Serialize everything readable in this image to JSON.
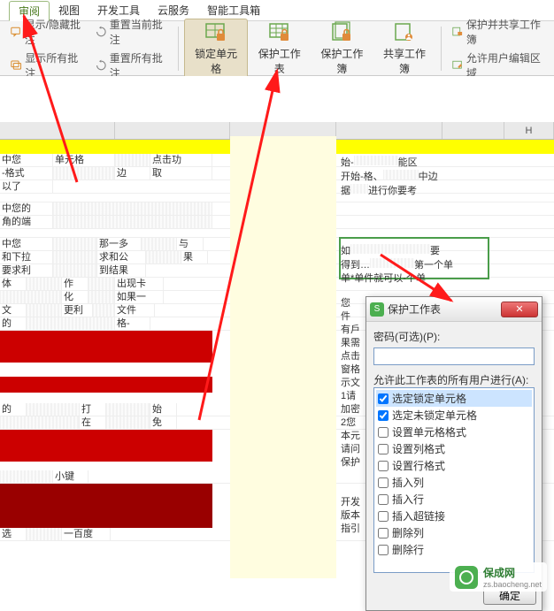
{
  "menu": {
    "items": [
      "审阅",
      "视图",
      "开发工具",
      "云服务",
      "智能工具箱"
    ],
    "active_index": 0
  },
  "ribbon": {
    "left": {
      "show_hide": "显示/隐藏批注",
      "show_all": "显示所有批注",
      "reset_current": "重置当前批注",
      "reset_all": "重置所有批注"
    },
    "big": [
      {
        "label": "锁定单元格",
        "active": true
      },
      {
        "label": "保护工作表",
        "active": false
      },
      {
        "label": "保护工作簿",
        "active": false
      },
      {
        "label": "共享工作簿",
        "active": false
      }
    ],
    "right": {
      "protect_share": "保护并共享工作簿",
      "allow_edit": "允许用户编辑区域"
    }
  },
  "cols": {
    "letters": [
      "",
      "",
      "",
      "",
      "",
      "H"
    ]
  },
  "cells": {
    "r1a": "中您",
    "r1b": "单元格",
    "r1c": "点击功",
    "r2a": "-格式",
    "r2b": "边",
    "r2c": "取",
    "r3a": "以了",
    "r4a": "中您的",
    "r4b": "",
    "r5a": "角的端",
    "r5b": "",
    "r6a": "中您",
    "r6b": "那一多",
    "r6c": "与",
    "r7a": "和下拉",
    "r7b": "求和公",
    "r7c": "果",
    "r8a": "要求利",
    "r8b": "到结果",
    "r9a": "体",
    "r9b": "作",
    "r9c": "出现卡",
    "r10a": "",
    "r10b": "化",
    "r10c": "如果一",
    "r11a": "文",
    "r11b": "更利",
    "r11c": "文件",
    "r12a": "的",
    "r12b": "",
    "r12c": "格-",
    "r13a": "的",
    "r13b": "打",
    "r13c": "始",
    "r14a": "",
    "r14b": "在",
    "r14c": "免",
    "r15a": "小键",
    "r16a": "选",
    "r16b": "一百度",
    "right1a": "始-",
    "right1b": "能区",
    "right2a": "开始-格、",
    "right2b": "中边",
    "right3a": "据",
    "right3b": "进行你要考",
    "right4a": "如",
    "right4b": "要",
    "right5a": "得到…",
    "right5b": "第一个单",
    "right6a": "单*单件就可以",
    "right6b": "-个单",
    "right7": "您",
    "right8": "件",
    "right9": "有戶",
    "right10": "果需",
    "right11": "点击",
    "right12": "窗格",
    "right13": "示文",
    "right14": "1请",
    "right15": "加密",
    "right16": "2您",
    "right17": "本元",
    "right18": "请问",
    "right19": "保护",
    "right20": "开发",
    "right21": "版本",
    "right22": "指引"
  },
  "dialog": {
    "title": "保护工作表",
    "password_label": "密码(可选)(P):",
    "password_value": "",
    "allow_label": "允许此工作表的所有用户进行(A):",
    "permissions": [
      {
        "label": "选定锁定单元格",
        "checked": true
      },
      {
        "label": "选定未锁定单元格",
        "checked": true
      },
      {
        "label": "设置单元格格式",
        "checked": false
      },
      {
        "label": "设置列格式",
        "checked": false
      },
      {
        "label": "设置行格式",
        "checked": false
      },
      {
        "label": "插入列",
        "checked": false
      },
      {
        "label": "插入行",
        "checked": false
      },
      {
        "label": "插入超链接",
        "checked": false
      },
      {
        "label": "删除列",
        "checked": false
      },
      {
        "label": "删除行",
        "checked": false
      }
    ],
    "ok": "确定"
  },
  "watermark": {
    "name": "保成网",
    "url": "zs.baocheng.net"
  }
}
